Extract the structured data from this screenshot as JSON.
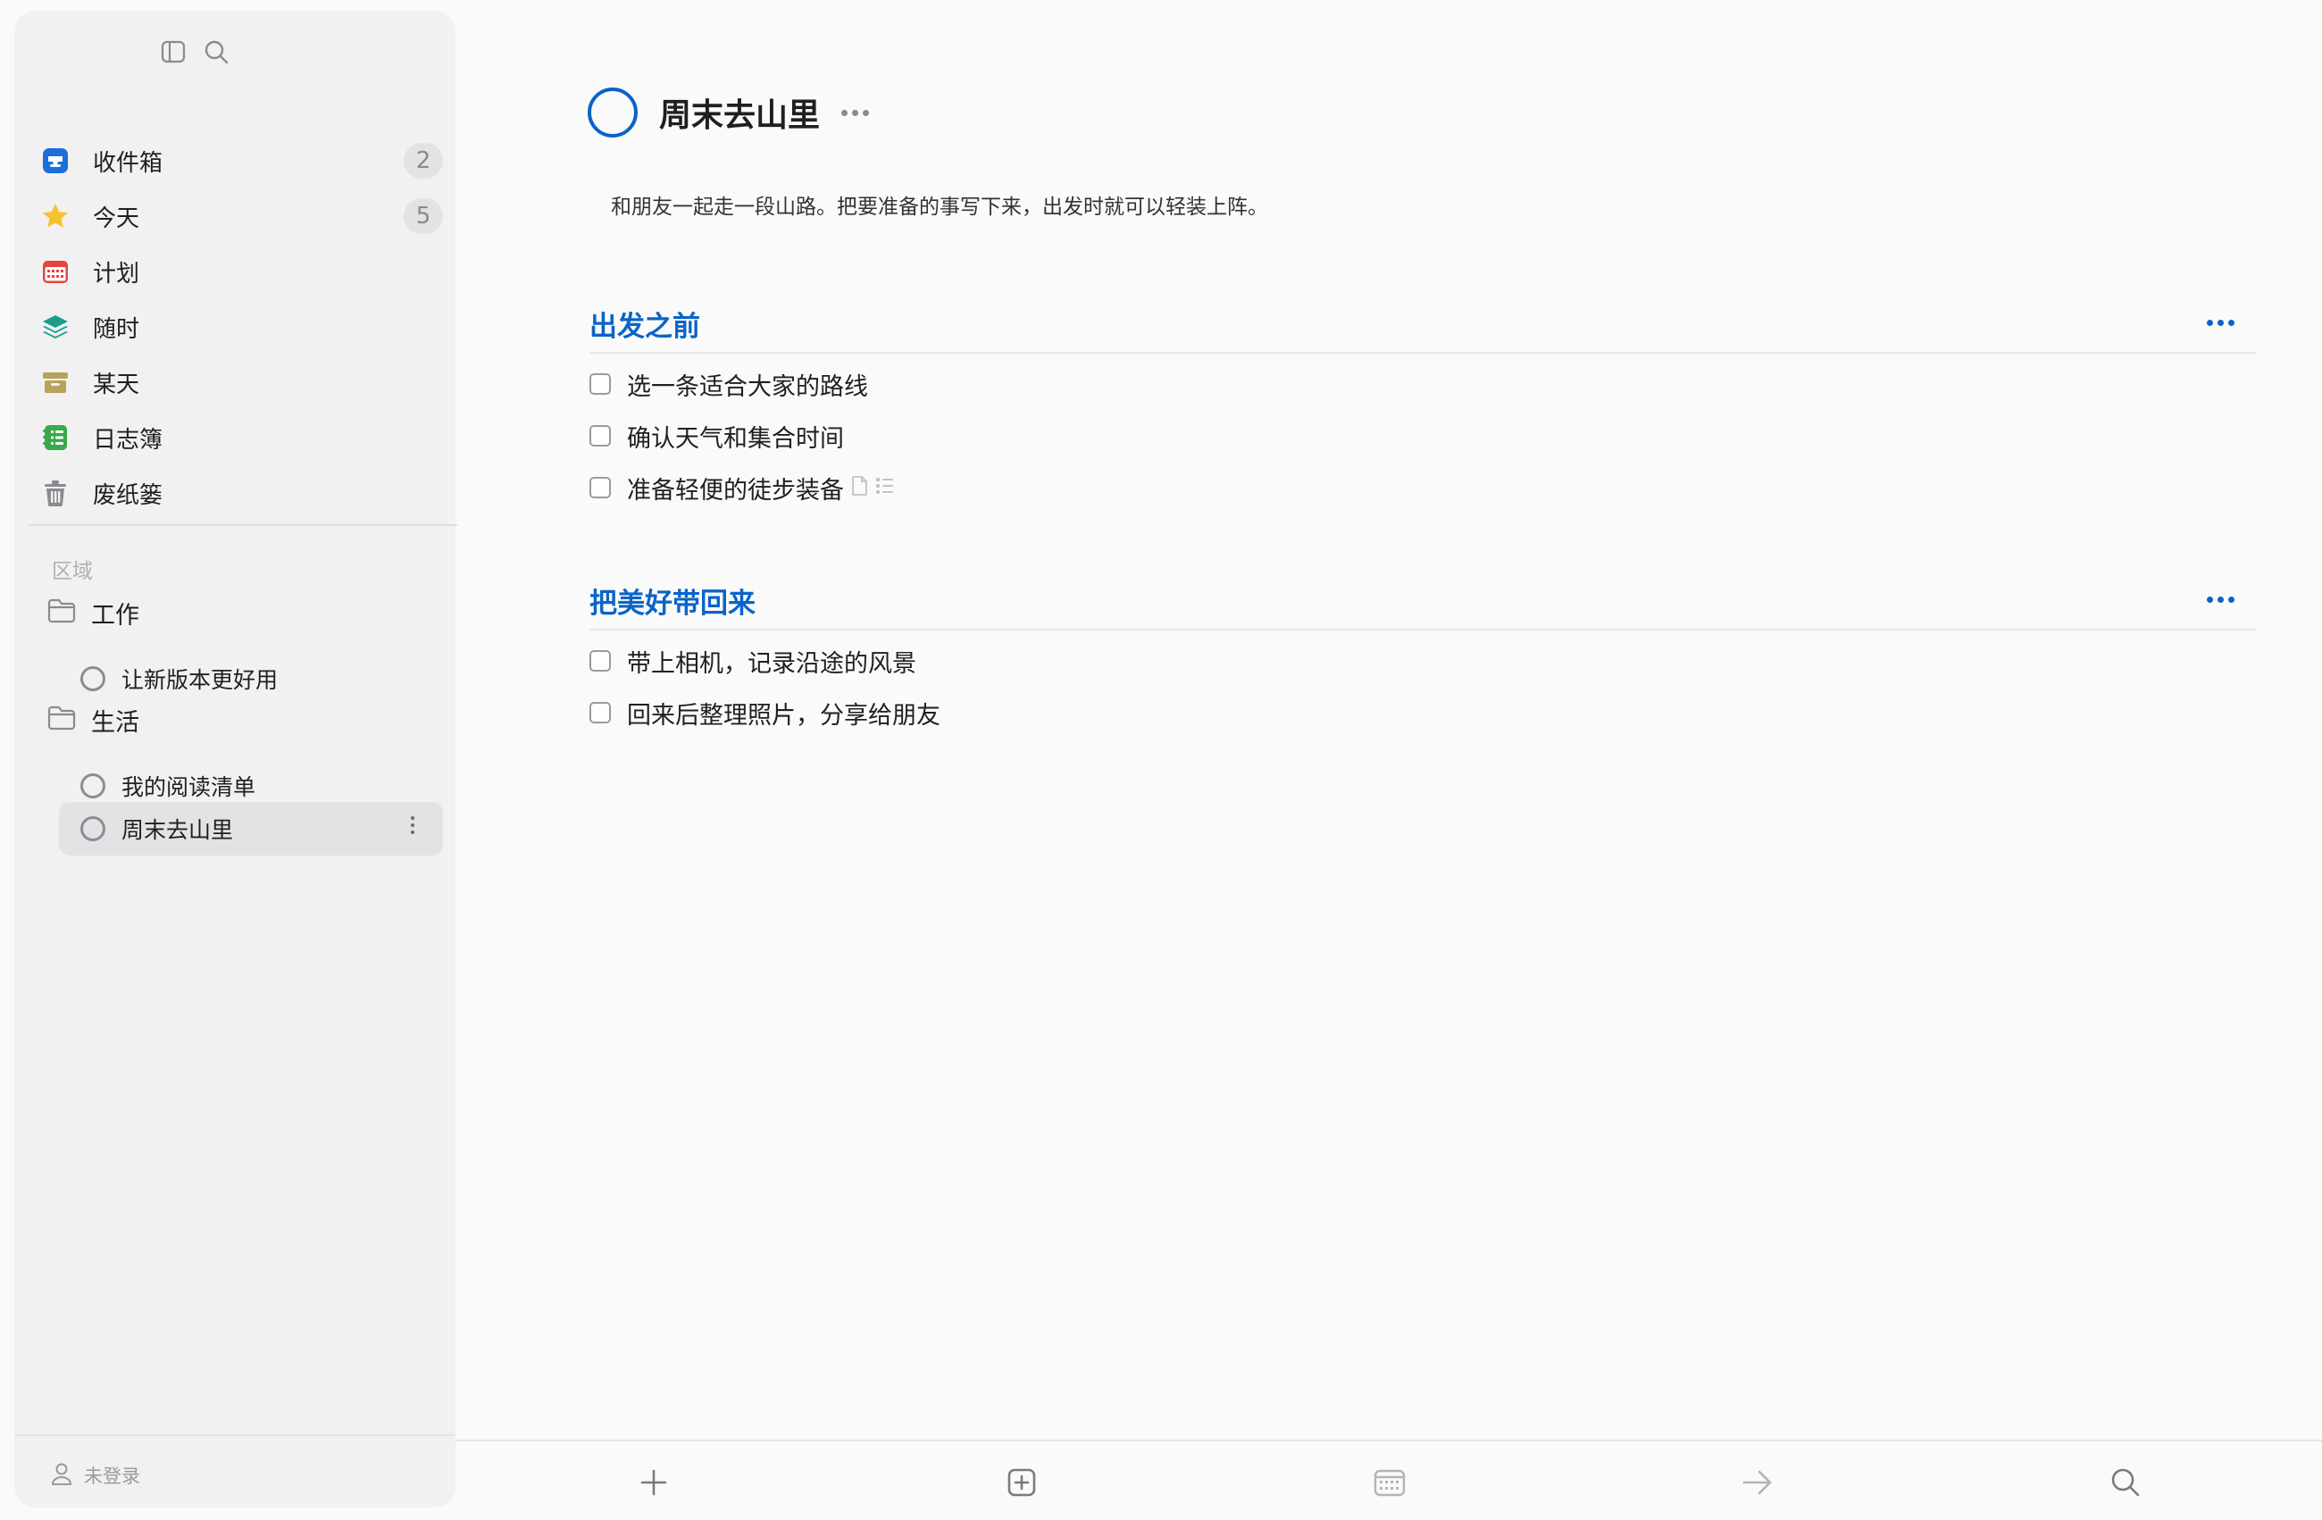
{
  "sidebar": {
    "nav": [
      {
        "label": "收件箱",
        "badge": "2",
        "icon": "inbox-icon",
        "color": "#1a6fd8"
      },
      {
        "label": "今天",
        "badge": "5",
        "icon": "star-icon",
        "color": "#f6c22e"
      },
      {
        "label": "计划",
        "badge": "",
        "icon": "calendar-icon",
        "color": "#e8423f"
      },
      {
        "label": "随时",
        "badge": "",
        "icon": "layers-icon",
        "color": "#1e9c8c"
      },
      {
        "label": "某天",
        "badge": "",
        "icon": "archive-box-icon",
        "color": "#b9a259"
      },
      {
        "label": "日志簿",
        "badge": "",
        "icon": "logbook-icon",
        "color": "#3aa84b"
      },
      {
        "label": "废纸篓",
        "badge": "",
        "icon": "trash-icon",
        "color": "#8b8b8f"
      }
    ],
    "section_label": "区域",
    "areas": [
      {
        "name": "工作",
        "projects": [
          "让新版本更好用"
        ]
      },
      {
        "name": "生活",
        "projects": [
          "我的阅读清单",
          "周末去山里"
        ]
      }
    ],
    "selected_project": "周末去山里",
    "user_label": "未登录"
  },
  "project": {
    "title": "周末去山里",
    "notes": "和朋友一起走一段山路。把要准备的事写下来，出发时就可以轻装上阵。",
    "headings": [
      {
        "title": "出发之前",
        "todos": [
          {
            "text": "选一条适合大家的路线",
            "has_note": false,
            "has_checklist": false
          },
          {
            "text": "确认天气和集合时间",
            "has_note": false,
            "has_checklist": false
          },
          {
            "text": "准备轻便的徒步装备",
            "has_note": true,
            "has_checklist": true
          }
        ]
      },
      {
        "title": "把美好带回来",
        "todos": [
          {
            "text": "带上相机，记录沿途的风景",
            "has_note": false,
            "has_checklist": false
          },
          {
            "text": "回来后整理照片，分享给朋友",
            "has_note": false,
            "has_checklist": false
          }
        ]
      }
    ]
  },
  "toolbar": {
    "buttons": [
      "add-todo-icon",
      "add-heading-icon",
      "calendar-icon",
      "move-arrow-icon",
      "search-icon"
    ]
  },
  "colors": {
    "accent": "#0a64c8",
    "sidebar_bg": "#f1f1f2",
    "main_bg": "#fafafa"
  }
}
